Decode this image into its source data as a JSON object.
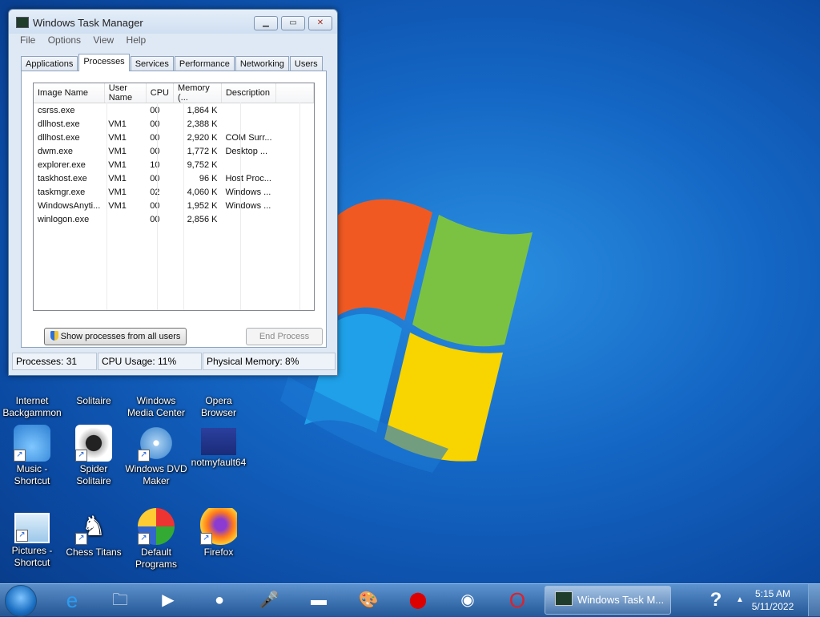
{
  "window": {
    "title": "Windows Task Manager",
    "menu": [
      "File",
      "Options",
      "View",
      "Help"
    ],
    "tabs": [
      "Applications",
      "Processes",
      "Services",
      "Performance",
      "Networking",
      "Users"
    ],
    "active_tab": "Processes",
    "columns": [
      "Image Name",
      "User Name",
      "CPU",
      "Memory (...",
      "Description"
    ],
    "rows": [
      {
        "image": "csrss.exe",
        "user": "",
        "cpu": "00",
        "mem": "1,864 K",
        "desc": ""
      },
      {
        "image": "dllhost.exe",
        "user": "VM1",
        "cpu": "00",
        "mem": "2,388 K",
        "desc": ""
      },
      {
        "image": "dllhost.exe",
        "user": "VM1",
        "cpu": "00",
        "mem": "2,920 K",
        "desc": "COM Surr..."
      },
      {
        "image": "dwm.exe",
        "user": "VM1",
        "cpu": "00",
        "mem": "1,772 K",
        "desc": "Desktop ..."
      },
      {
        "image": "explorer.exe",
        "user": "VM1",
        "cpu": "10",
        "mem": "9,752 K",
        "desc": ""
      },
      {
        "image": "taskhost.exe",
        "user": "VM1",
        "cpu": "00",
        "mem": "96 K",
        "desc": "Host Proc..."
      },
      {
        "image": "taskmgr.exe",
        "user": "VM1",
        "cpu": "02",
        "mem": "4,060 K",
        "desc": "Windows ..."
      },
      {
        "image": "WindowsAnyti...",
        "user": "VM1",
        "cpu": "00",
        "mem": "1,952 K",
        "desc": "Windows ..."
      },
      {
        "image": "winlogon.exe",
        "user": "",
        "cpu": "00",
        "mem": "2,856 K",
        "desc": ""
      }
    ],
    "show_all_label": "Show processes from all users",
    "end_process_label": "End Process",
    "status": {
      "processes": "Processes: 31",
      "cpu": "CPU Usage: 11%",
      "memory": "Physical Memory: 8%"
    }
  },
  "desktop_icons": [
    {
      "label": "Internet Backgammon",
      "icon": "backgammon-icon"
    },
    {
      "label": "Solitaire",
      "icon": "solitaire-icon"
    },
    {
      "label": "Windows Media Center",
      "icon": "media-center-icon"
    },
    {
      "label": "Opera Browser",
      "icon": "opera-icon"
    },
    {
      "label": "Music - Shortcut",
      "icon": "music-icon"
    },
    {
      "label": "Spider Solitaire",
      "icon": "spider-icon"
    },
    {
      "label": "Windows DVD Maker",
      "icon": "dvd-icon"
    },
    {
      "label": "notmyfault64",
      "icon": "notmyfault-icon"
    },
    {
      "label": "Pictures - Shortcut",
      "icon": "pictures-icon"
    },
    {
      "label": "Chess Titans",
      "icon": "chess-icon"
    },
    {
      "label": "Default Programs",
      "icon": "default-programs-icon"
    },
    {
      "label": "Firefox",
      "icon": "firefox-icon"
    }
  ],
  "taskbar": {
    "active_window": "Windows Task M...",
    "time": "5:15 AM",
    "date": "5/11/2022"
  }
}
